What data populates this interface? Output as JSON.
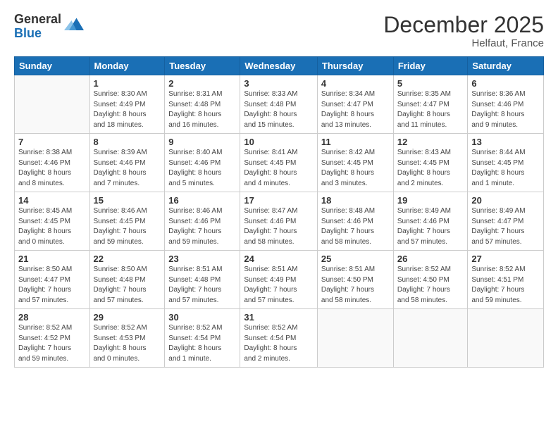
{
  "logo": {
    "general": "General",
    "blue": "Blue"
  },
  "header": {
    "title": "December 2025",
    "subtitle": "Helfaut, France"
  },
  "weekdays": [
    "Sunday",
    "Monday",
    "Tuesday",
    "Wednesday",
    "Thursday",
    "Friday",
    "Saturday"
  ],
  "weeks": [
    [
      {
        "day": "",
        "info": ""
      },
      {
        "day": "1",
        "info": "Sunrise: 8:30 AM\nSunset: 4:49 PM\nDaylight: 8 hours\nand 18 minutes."
      },
      {
        "day": "2",
        "info": "Sunrise: 8:31 AM\nSunset: 4:48 PM\nDaylight: 8 hours\nand 16 minutes."
      },
      {
        "day": "3",
        "info": "Sunrise: 8:33 AM\nSunset: 4:48 PM\nDaylight: 8 hours\nand 15 minutes."
      },
      {
        "day": "4",
        "info": "Sunrise: 8:34 AM\nSunset: 4:47 PM\nDaylight: 8 hours\nand 13 minutes."
      },
      {
        "day": "5",
        "info": "Sunrise: 8:35 AM\nSunset: 4:47 PM\nDaylight: 8 hours\nand 11 minutes."
      },
      {
        "day": "6",
        "info": "Sunrise: 8:36 AM\nSunset: 4:46 PM\nDaylight: 8 hours\nand 9 minutes."
      }
    ],
    [
      {
        "day": "7",
        "info": "Sunrise: 8:38 AM\nSunset: 4:46 PM\nDaylight: 8 hours\nand 8 minutes."
      },
      {
        "day": "8",
        "info": "Sunrise: 8:39 AM\nSunset: 4:46 PM\nDaylight: 8 hours\nand 7 minutes."
      },
      {
        "day": "9",
        "info": "Sunrise: 8:40 AM\nSunset: 4:46 PM\nDaylight: 8 hours\nand 5 minutes."
      },
      {
        "day": "10",
        "info": "Sunrise: 8:41 AM\nSunset: 4:45 PM\nDaylight: 8 hours\nand 4 minutes."
      },
      {
        "day": "11",
        "info": "Sunrise: 8:42 AM\nSunset: 4:45 PM\nDaylight: 8 hours\nand 3 minutes."
      },
      {
        "day": "12",
        "info": "Sunrise: 8:43 AM\nSunset: 4:45 PM\nDaylight: 8 hours\nand 2 minutes."
      },
      {
        "day": "13",
        "info": "Sunrise: 8:44 AM\nSunset: 4:45 PM\nDaylight: 8 hours\nand 1 minute."
      }
    ],
    [
      {
        "day": "14",
        "info": "Sunrise: 8:45 AM\nSunset: 4:45 PM\nDaylight: 8 hours\nand 0 minutes."
      },
      {
        "day": "15",
        "info": "Sunrise: 8:46 AM\nSunset: 4:45 PM\nDaylight: 7 hours\nand 59 minutes."
      },
      {
        "day": "16",
        "info": "Sunrise: 8:46 AM\nSunset: 4:46 PM\nDaylight: 7 hours\nand 59 minutes."
      },
      {
        "day": "17",
        "info": "Sunrise: 8:47 AM\nSunset: 4:46 PM\nDaylight: 7 hours\nand 58 minutes."
      },
      {
        "day": "18",
        "info": "Sunrise: 8:48 AM\nSunset: 4:46 PM\nDaylight: 7 hours\nand 58 minutes."
      },
      {
        "day": "19",
        "info": "Sunrise: 8:49 AM\nSunset: 4:46 PM\nDaylight: 7 hours\nand 57 minutes."
      },
      {
        "day": "20",
        "info": "Sunrise: 8:49 AM\nSunset: 4:47 PM\nDaylight: 7 hours\nand 57 minutes."
      }
    ],
    [
      {
        "day": "21",
        "info": "Sunrise: 8:50 AM\nSunset: 4:47 PM\nDaylight: 7 hours\nand 57 minutes."
      },
      {
        "day": "22",
        "info": "Sunrise: 8:50 AM\nSunset: 4:48 PM\nDaylight: 7 hours\nand 57 minutes."
      },
      {
        "day": "23",
        "info": "Sunrise: 8:51 AM\nSunset: 4:48 PM\nDaylight: 7 hours\nand 57 minutes."
      },
      {
        "day": "24",
        "info": "Sunrise: 8:51 AM\nSunset: 4:49 PM\nDaylight: 7 hours\nand 57 minutes."
      },
      {
        "day": "25",
        "info": "Sunrise: 8:51 AM\nSunset: 4:50 PM\nDaylight: 7 hours\nand 58 minutes."
      },
      {
        "day": "26",
        "info": "Sunrise: 8:52 AM\nSunset: 4:50 PM\nDaylight: 7 hours\nand 58 minutes."
      },
      {
        "day": "27",
        "info": "Sunrise: 8:52 AM\nSunset: 4:51 PM\nDaylight: 7 hours\nand 59 minutes."
      }
    ],
    [
      {
        "day": "28",
        "info": "Sunrise: 8:52 AM\nSunset: 4:52 PM\nDaylight: 7 hours\nand 59 minutes."
      },
      {
        "day": "29",
        "info": "Sunrise: 8:52 AM\nSunset: 4:53 PM\nDaylight: 8 hours\nand 0 minutes."
      },
      {
        "day": "30",
        "info": "Sunrise: 8:52 AM\nSunset: 4:54 PM\nDaylight: 8 hours\nand 1 minute."
      },
      {
        "day": "31",
        "info": "Sunrise: 8:52 AM\nSunset: 4:54 PM\nDaylight: 8 hours\nand 2 minutes."
      },
      {
        "day": "",
        "info": ""
      },
      {
        "day": "",
        "info": ""
      },
      {
        "day": "",
        "info": ""
      }
    ]
  ]
}
